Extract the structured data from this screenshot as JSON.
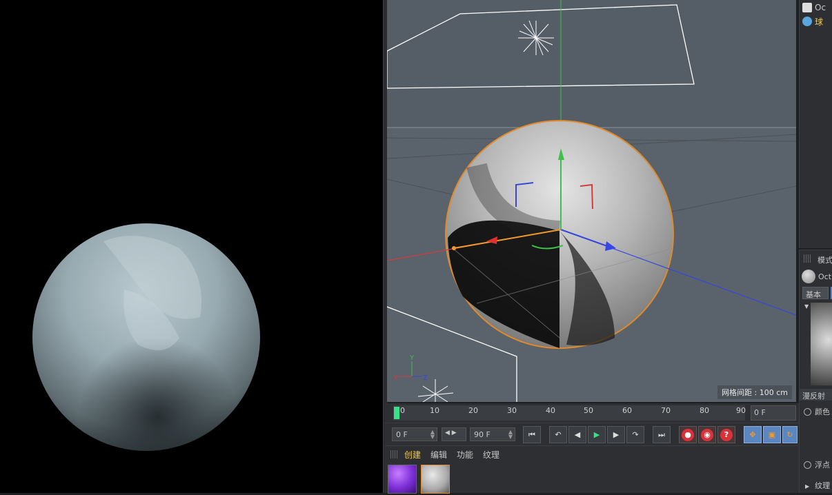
{
  "viewport": {
    "grid_label": "网格间距 : 100 cm"
  },
  "timeline": {
    "ticks": [
      "0",
      "10",
      "20",
      "30",
      "40",
      "50",
      "60",
      "70",
      "80",
      "90"
    ],
    "current_frame": "0 F"
  },
  "playback": {
    "start_field": "0 F",
    "end_field": "90 F"
  },
  "material_manager": {
    "menu": [
      "创建",
      "编辑",
      "功能",
      "纹理"
    ]
  },
  "object_manager": {
    "items": [
      {
        "label": "Oc"
      },
      {
        "label": "球"
      }
    ]
  },
  "attributes": {
    "title": "模式",
    "material_name": "Oct",
    "tab_basic": "基本",
    "section": "漫反射",
    "color_label": "颜色",
    "float_label": "浮点",
    "texture_label": "纹理"
  },
  "colors": {
    "accent": "#f2c94c",
    "timeline_marker": "#38e08a",
    "selection_outline": "#e08a2a",
    "button_blue": "#5b86c0",
    "button_red": "#d8333a"
  }
}
